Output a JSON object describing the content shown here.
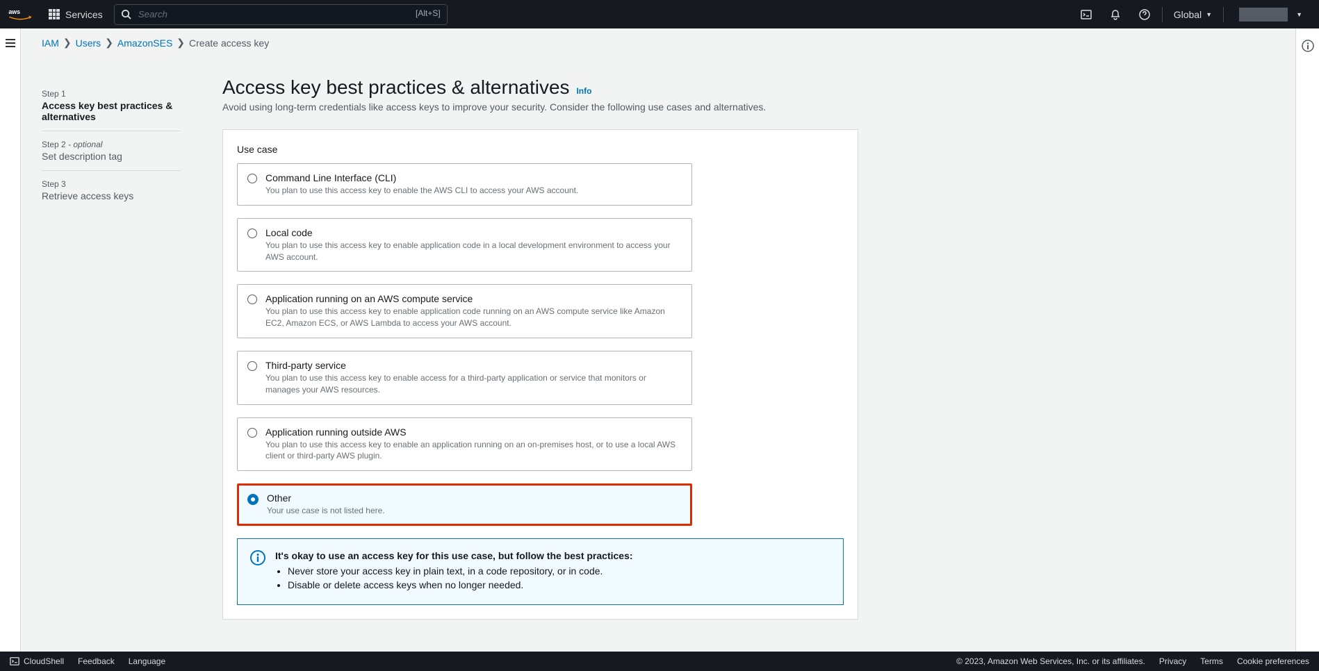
{
  "topnav": {
    "services": "Services",
    "search_placeholder": "Search",
    "search_shortcut": "[Alt+S]",
    "region_label": "Global"
  },
  "breadcrumb": {
    "iam": "IAM",
    "users": "Users",
    "user": "AmazonSES",
    "current": "Create access key"
  },
  "wizard": {
    "step1_num": "Step 1",
    "step1_title": "Access key best practices & alternatives",
    "step2_num": "Step 2",
    "step2_opt": " - optional",
    "step2_title": "Set description tag",
    "step3_num": "Step 3",
    "step3_title": "Retrieve access keys"
  },
  "page": {
    "title": "Access key best practices & alternatives",
    "info": "Info",
    "sub": "Avoid using long-term credentials like access keys to improve your security. Consider the following use cases and alternatives."
  },
  "card": {
    "heading": "Use case",
    "options": [
      {
        "title": "Command Line Interface (CLI)",
        "desc": "You plan to use this access key to enable the AWS CLI to access your AWS account."
      },
      {
        "title": "Local code",
        "desc": "You plan to use this access key to enable application code in a local development environment to access your AWS account."
      },
      {
        "title": "Application running on an AWS compute service",
        "desc": "You plan to use this access key to enable application code running on an AWS compute service like Amazon EC2, Amazon ECS, or AWS Lambda to access your AWS account."
      },
      {
        "title": "Third-party service",
        "desc": "You plan to use this access key to enable access for a third-party application or service that monitors or manages your AWS resources."
      },
      {
        "title": "Application running outside AWS",
        "desc": "You plan to use this access key to enable an application running on an on-premises host, or to use a local AWS client or third-party AWS plugin."
      },
      {
        "title": "Other",
        "desc": "Your use case is not listed here."
      }
    ],
    "info_title": "It's okay to use an access key for this use case, but follow the best practices:",
    "info_items": [
      "Never store your access key in plain text, in a code repository, or in code.",
      "Disable or delete access keys when no longer needed."
    ]
  },
  "footer": {
    "cloudshell": "CloudShell",
    "feedback": "Feedback",
    "language": "Language",
    "copyright": "© 2023, Amazon Web Services, Inc. or its affiliates.",
    "privacy": "Privacy",
    "terms": "Terms",
    "cookies": "Cookie preferences"
  }
}
